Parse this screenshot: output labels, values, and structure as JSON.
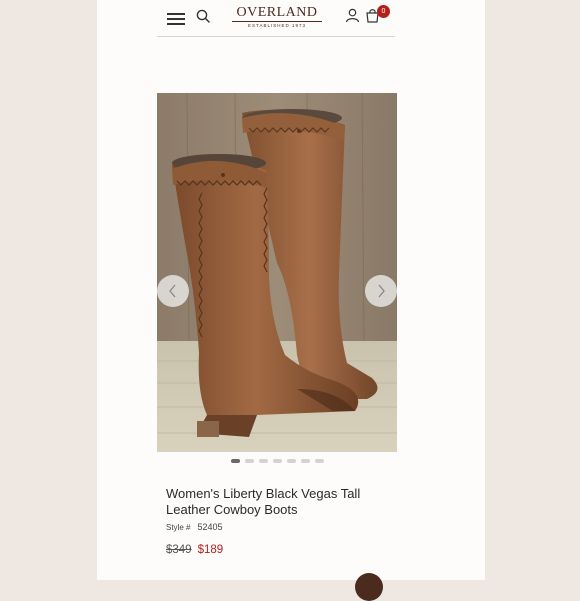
{
  "header": {
    "logo_text": "OVERLAND",
    "logo_sub": "ESTABLISHED 1973",
    "cart_count": "0",
    "icons": [
      "menu-icon",
      "search-icon",
      "account-icon",
      "cart-icon"
    ]
  },
  "carousel": {
    "image_count": 7,
    "active_index": 0,
    "prev_icon": "chevron-left-icon",
    "next_icon": "chevron-right-icon"
  },
  "product": {
    "title": "Women's Liberty Black Vegas Tall Leather Cowboy Boots",
    "style_label": "Style #",
    "style_number": "52405",
    "old_price": "$349",
    "sale_price": "$189"
  },
  "colors": {
    "brand": "#4a2b1e",
    "sale": "#b0211d",
    "badge": "#b0211d"
  }
}
